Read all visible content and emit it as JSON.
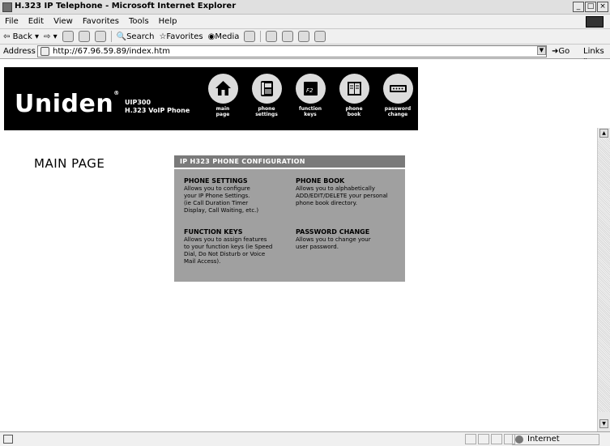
{
  "window": {
    "title": "H.323 IP Telephone - Microsoft Internet Explorer"
  },
  "menu": [
    "File",
    "Edit",
    "View",
    "Favorites",
    "Tools",
    "Help"
  ],
  "toolbar": {
    "back": "Back",
    "search": "Search",
    "favorites": "Favorites",
    "media": "Media"
  },
  "address": {
    "label": "Address",
    "url": "http://67.96.59.89/index.htm",
    "go": "Go",
    "links": "Links »"
  },
  "header": {
    "logo": "Uniden",
    "model_line1": "UIP300",
    "model_line2": "H.323 VoIP Phone",
    "nav": [
      {
        "line1": "main",
        "line2": "page",
        "icon": "house-icon"
      },
      {
        "line1": "phone",
        "line2": "settings",
        "icon": "phone-settings-icon"
      },
      {
        "line1": "function",
        "line2": "keys",
        "icon": "function-keys-icon"
      },
      {
        "line1": "phone",
        "line2": "book",
        "icon": "phone-book-icon"
      },
      {
        "line1": "password",
        "line2": "change",
        "icon": "password-icon"
      }
    ]
  },
  "main": {
    "title": "MAIN PAGE"
  },
  "panel": {
    "heading": "IP H323 PHONE CONFIGURATION",
    "sections": [
      {
        "title": "PHONE SETTINGS",
        "lines": [
          "Allows you to configure",
          "your IP Phone Settings.",
          "(ie Call Duration Timer",
          "Display, Call Waiting, etc.)"
        ]
      },
      {
        "title": "PHONE BOOK",
        "lines": [
          "Allows you to alphabetically",
          "ADD/EDIT/DELETE your personal",
          "phone book directory."
        ]
      },
      {
        "title": "FUNCTION KEYS",
        "lines": [
          "Allows you to assign features",
          "to your function keys (ie Speed",
          "Dial, Do Not Disturb or Voice",
          "Mail Access)."
        ]
      },
      {
        "title": "PASSWORD CHANGE",
        "lines": [
          "Allows you to change your",
          "user password."
        ]
      }
    ]
  },
  "status": {
    "zone": "Internet"
  },
  "colors": {
    "header_bg": "#000000",
    "panel_bg": "#a0a0a0",
    "panel_head_bg": "#7a7a7a"
  }
}
